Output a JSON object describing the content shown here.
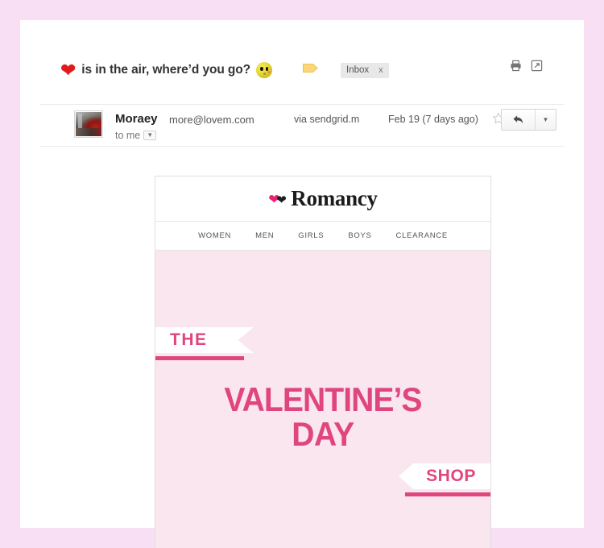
{
  "theme": {
    "page_border_color": "#f9dff3",
    "accent_pink": "#e0467e",
    "hero_background": "#fae6ee",
    "brand_heart_pink": "#ec2073"
  },
  "mail_header": {
    "subject_heart_icon": "red-heart-icon",
    "subject_text": "is in the air, where’d you go?",
    "subject_emoji_icon": "surprised-face-emoji",
    "label_icon": "label-tag-icon",
    "label_chip": "Inbox",
    "label_chip_remove": "x",
    "print_icon": "printer-icon",
    "popout_icon": "open-in-new-window-icon"
  },
  "sender": {
    "avatar": "sender-avatar-photo",
    "name": "Moraey",
    "email": "more@lovem.com",
    "recipients": "to me",
    "recipients_caret_icon": "chevron-down-icon",
    "via_word": "via",
    "via_domain": "sendgrid.m",
    "date": "Feb 19 (7 days ago)",
    "star_icon": "star-outline-icon",
    "reply_icon": "reply-arrow-icon",
    "reply_more_icon": "chevron-down-icon"
  },
  "email_body": {
    "brand": {
      "heart_pink_icon": "pink-heart-icon",
      "heart_black_icon": "black-heart-icon",
      "name": "Romancy"
    },
    "nav": [
      {
        "label": "WOMEN"
      },
      {
        "label": "MEN"
      },
      {
        "label": "GIRLS"
      },
      {
        "label": "BOYS"
      },
      {
        "label": "CLEARANCE"
      }
    ],
    "hero": {
      "ribbon_the": "THE",
      "headline_line1": "VALENTINE’S",
      "headline_line2": "DAY",
      "ribbon_shop": "SHOP"
    }
  }
}
